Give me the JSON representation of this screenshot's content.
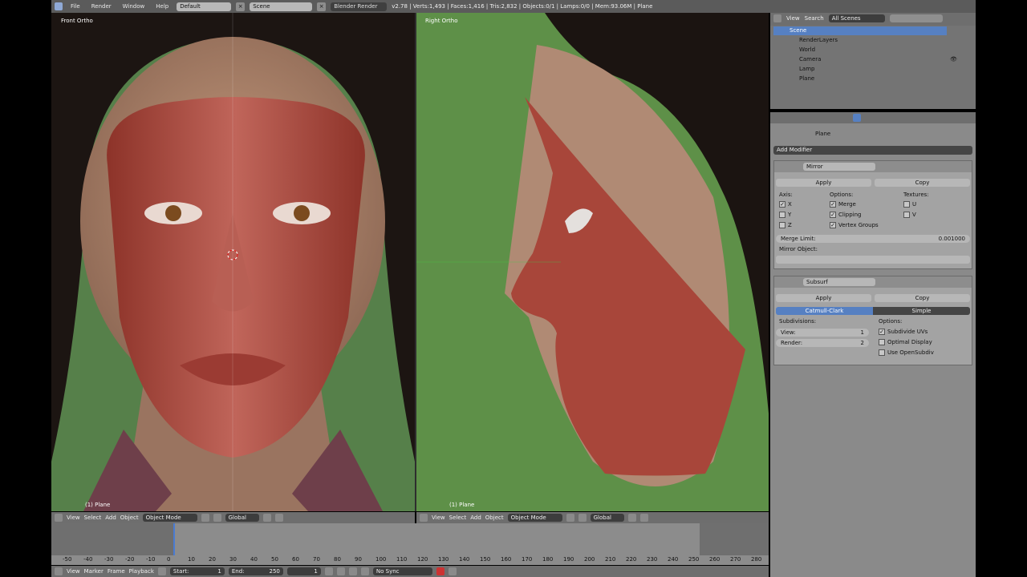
{
  "topbar": {
    "menus": [
      "File",
      "Render",
      "Window",
      "Help"
    ],
    "screen_layout": "Default",
    "scene": "Scene",
    "engine": "Blender Render",
    "stats": "v2.78 | Verts:1,493 | Faces:1,416 | Tris:2,832 | Objects:0/1 | Lamps:0/0 | Mem:93.06M | Plane"
  },
  "left_view": {
    "title": "Front Ortho",
    "object": "(1) Plane"
  },
  "right_view": {
    "title": "Right Ortho",
    "object": "(1) Plane"
  },
  "view_header": {
    "menus": [
      "View",
      "Select",
      "Add",
      "Object"
    ],
    "mode": "Object Mode",
    "orientation": "Global"
  },
  "timeline": {
    "ticks": [
      "-50",
      "-40",
      "-30",
      "-20",
      "-10",
      "0",
      "10",
      "20",
      "30",
      "40",
      "50",
      "60",
      "70",
      "80",
      "90",
      "100",
      "110",
      "120",
      "130",
      "140",
      "150",
      "160",
      "170",
      "180",
      "190",
      "200",
      "210",
      "220",
      "230",
      "240",
      "250",
      "260",
      "270",
      "280"
    ],
    "menus": [
      "View",
      "Marker",
      "Frame",
      "Playback"
    ],
    "start_label": "Start:",
    "start": "1",
    "end_label": "End:",
    "end": "250",
    "current": "1",
    "sync": "No Sync"
  },
  "outliner": {
    "menus": [
      "View",
      "Search"
    ],
    "filter": "All Scenes",
    "items": [
      {
        "label": "Scene",
        "selected": true
      },
      {
        "label": "RenderLayers"
      },
      {
        "label": "World"
      },
      {
        "label": "Camera"
      },
      {
        "label": "Lamp"
      },
      {
        "label": "Plane"
      }
    ]
  },
  "properties": {
    "object": "Plane",
    "add_modifier": "Add Modifier",
    "mirror": {
      "name": "Mirror",
      "apply": "Apply",
      "copy": "Copy",
      "axis_label": "Axis:",
      "options_label": "Options:",
      "textures_label": "Textures:",
      "axes": [
        "X",
        "Y",
        "Z"
      ],
      "options": [
        "Merge",
        "Clipping",
        "Vertex Groups"
      ],
      "textures": [
        "U",
        "V"
      ],
      "merge_limit_label": "Merge Limit:",
      "merge_limit": "0.001000",
      "mirror_object_label": "Mirror Object:"
    },
    "subsurf": {
      "name": "Subsurf",
      "apply": "Apply",
      "copy": "Copy",
      "tab_catmull": "Catmull-Clark",
      "tab_simple": "Simple",
      "subdivisions_label": "Subdivisions:",
      "options_label": "Options:",
      "view_label": "View:",
      "view": "1",
      "render_label": "Render:",
      "render": "2",
      "options": [
        "Subdivide UVs",
        "Optimal Display",
        "Use OpenSubdiv"
      ]
    }
  },
  "colors": {
    "mask": "#a8483c",
    "green_screen": "#5d8a4a",
    "accent_blue": "#5680c2",
    "panel": "#8a8a8a"
  }
}
